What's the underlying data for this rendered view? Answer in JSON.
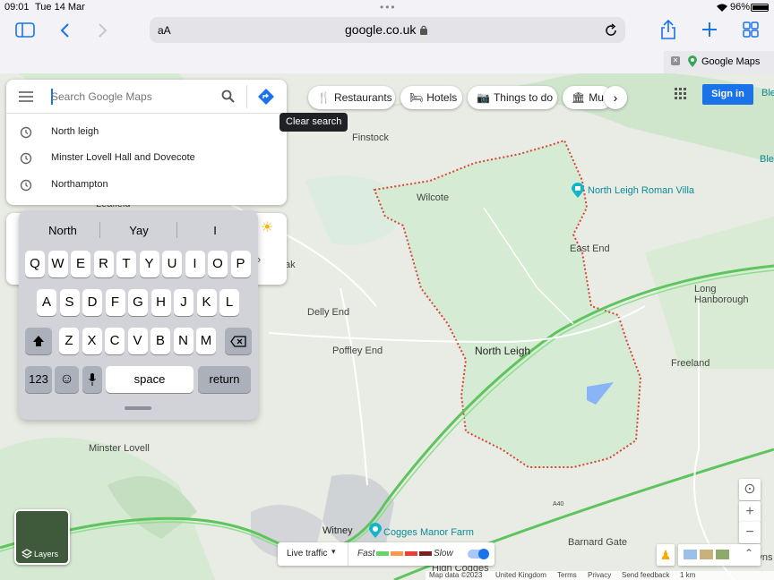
{
  "status": {
    "time": "09:01",
    "date": "Tue 14 Mar",
    "battery": "96%"
  },
  "browser": {
    "address_text": "aA",
    "url": "google.co.uk",
    "tab_title": "Google Maps"
  },
  "search": {
    "placeholder": "Search Google Maps",
    "recent": [
      "North leigh",
      "Minster Lovell Hall and Dovecote",
      "Northampton"
    ],
    "tooltip": "Clear search"
  },
  "chips": [
    "Restaurants",
    "Hotels",
    "Things to do",
    "Mus"
  ],
  "signin": "Sign in",
  "map_labels": {
    "finstock": "Finstock",
    "wilcote": "Wilcote",
    "roman_villa": "North Leigh Roman Villa",
    "east_end": "East End",
    "long_hanborough": "Long Hanborough",
    "delly_end": "Delly End",
    "poffley_end": "Poffley End",
    "north_leigh": "North Leigh",
    "freeland": "Freeland",
    "minster_lovell": "Minster Lovell",
    "witney": "Witney",
    "cogges": "Cogges Manor Farm",
    "barnard_gate": "Barnard Gate",
    "high_cogges": "High Cogges",
    "leafield": "Leafield",
    "ak": "ak",
    "ble1": "Ble",
    "ble2": "Ble",
    "eyns": "Eyns",
    "a40": "A40"
  },
  "keyboard": {
    "predictions": [
      "North",
      "Yay",
      "I"
    ],
    "row1": [
      "Q",
      "W",
      "E",
      "R",
      "T",
      "Y",
      "U",
      "I",
      "O",
      "P"
    ],
    "row2": [
      "A",
      "S",
      "D",
      "F",
      "G",
      "H",
      "J",
      "K",
      "L"
    ],
    "row3": [
      "Z",
      "X",
      "C",
      "V",
      "B",
      "N",
      "M"
    ],
    "numbers": "123",
    "space": "space",
    "return": "return"
  },
  "traffic": {
    "label": "Live traffic",
    "fast": "Fast",
    "slow": "Slow"
  },
  "layers": "Layers",
  "footer": [
    "Map data ©2023",
    "United Kingdom",
    "Terms",
    "Privacy",
    "Send feedback",
    "1 km"
  ],
  "colors": {
    "accent": "#1a73e8",
    "boundary": "#db4437",
    "road": "#4ecf4e"
  }
}
